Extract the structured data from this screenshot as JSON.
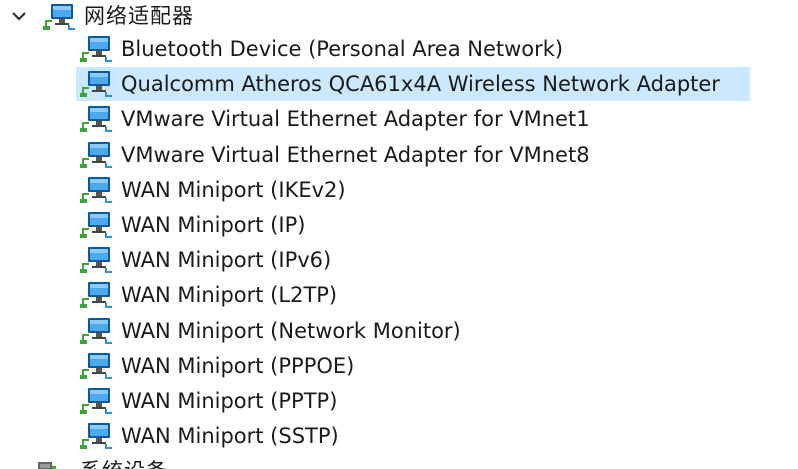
{
  "category": {
    "label": "网络适配器",
    "expanded": true,
    "icon": "network-adapter-icon"
  },
  "items": [
    {
      "label": "Bluetooth Device (Personal Area Network)",
      "selected": false
    },
    {
      "label": "Qualcomm Atheros QCA61x4A Wireless Network Adapter",
      "selected": true
    },
    {
      "label": "VMware Virtual Ethernet Adapter for VMnet1",
      "selected": false
    },
    {
      "label": "VMware Virtual Ethernet Adapter for VMnet8",
      "selected": false
    },
    {
      "label": "WAN Miniport (IKEv2)",
      "selected": false
    },
    {
      "label": "WAN Miniport (IP)",
      "selected": false
    },
    {
      "label": "WAN Miniport (IPv6)",
      "selected": false
    },
    {
      "label": "WAN Miniport (L2TP)",
      "selected": false
    },
    {
      "label": "WAN Miniport (Network Monitor)",
      "selected": false
    },
    {
      "label": "WAN Miniport (PPPOE)",
      "selected": false
    },
    {
      "label": "WAN Miniport (PPTP)",
      "selected": false
    },
    {
      "label": "WAN Miniport (SSTP)",
      "selected": false
    }
  ],
  "next_category": {
    "label": "系统设备",
    "icon": "system-device-icon"
  },
  "colors": {
    "selection": "#cce8ff",
    "monitor_blue": "#2f8fd8",
    "monitor_dark": "#0c5a9c",
    "cable_green": "#3aa63a",
    "chevron": "#333333"
  }
}
